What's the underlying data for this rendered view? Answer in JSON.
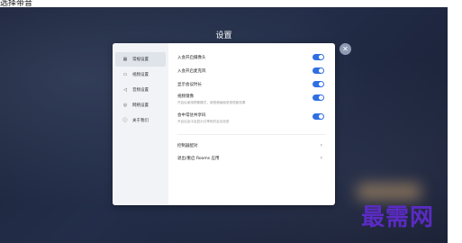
{
  "top_caption": "选择带音",
  "window": {
    "title": "设置"
  },
  "sidebar": {
    "items": [
      {
        "label": "常规设置",
        "icon": "grid-icon",
        "active": true
      },
      {
        "label": "视频设置",
        "icon": "camera-icon",
        "active": false
      },
      {
        "label": "音频设置",
        "icon": "speaker-icon",
        "active": false
      },
      {
        "label": "网络设置",
        "icon": "globe-icon",
        "active": false
      },
      {
        "label": "关于我们",
        "icon": "info-icon",
        "active": false
      }
    ]
  },
  "settings": {
    "toggles": [
      {
        "label": "入会开启摄像头",
        "desc": "",
        "on": true
      },
      {
        "label": "入会开启麦克风",
        "desc": "",
        "on": true
      },
      {
        "label": "显示会议时长",
        "desc": "",
        "on": true
      },
      {
        "label": "视频镜像",
        "desc": "开启后使用镜像模式，使视频画面呈现镜面效果",
        "on": true
      },
      {
        "label": "会中常驻共享码",
        "desc": "开启后会中会显示共享码的会议信息",
        "on": true
      }
    ],
    "links": [
      {
        "label": "控制器配对"
      },
      {
        "label": "退出/重启 Rooms 应用"
      }
    ]
  },
  "watermark": "最需网",
  "colors": {
    "accent": "#2f6fe4",
    "watermark": "#5b2bc4"
  }
}
